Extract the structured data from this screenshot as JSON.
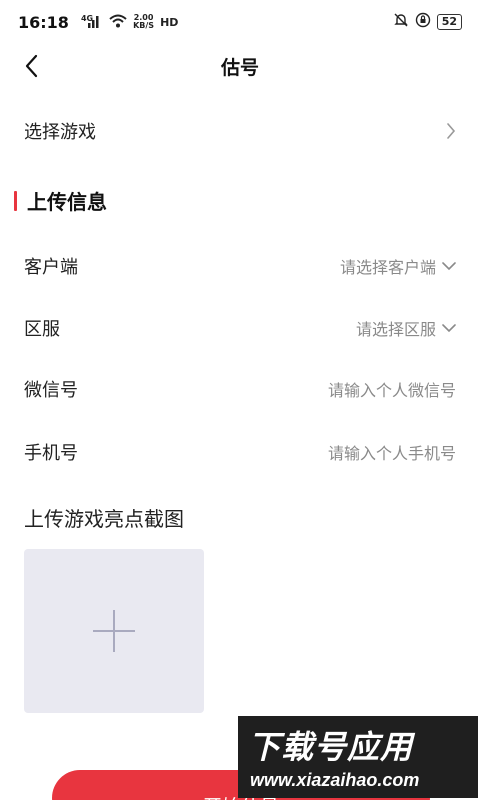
{
  "status_bar": {
    "time": "16:18",
    "signal_label": "4G",
    "net_speed": "2.00",
    "net_unit": "KB/S",
    "hd_label": "HD",
    "battery": "52"
  },
  "nav": {
    "title": "估号"
  },
  "select_game": {
    "label": "选择游戏"
  },
  "section": {
    "title": "上传信息"
  },
  "fields": [
    {
      "label": "客户端",
      "placeholder": "请选择客户端",
      "type": "select"
    },
    {
      "label": "区服",
      "placeholder": "请选择区服",
      "type": "select"
    },
    {
      "label": "微信号",
      "placeholder": "请输入个人微信号",
      "type": "input"
    },
    {
      "label": "手机号",
      "placeholder": "请输入个人手机号",
      "type": "input"
    }
  ],
  "upload": {
    "title": "上传游戏亮点截图"
  },
  "submit": {
    "label": "开始估号"
  },
  "watermark": {
    "text": "下载号应用",
    "url": "www.xiazaihao.com"
  },
  "colors": {
    "accent": "#e8353f",
    "upload_bg": "#e9e9f1",
    "placeholder": "#8a8a8a"
  }
}
